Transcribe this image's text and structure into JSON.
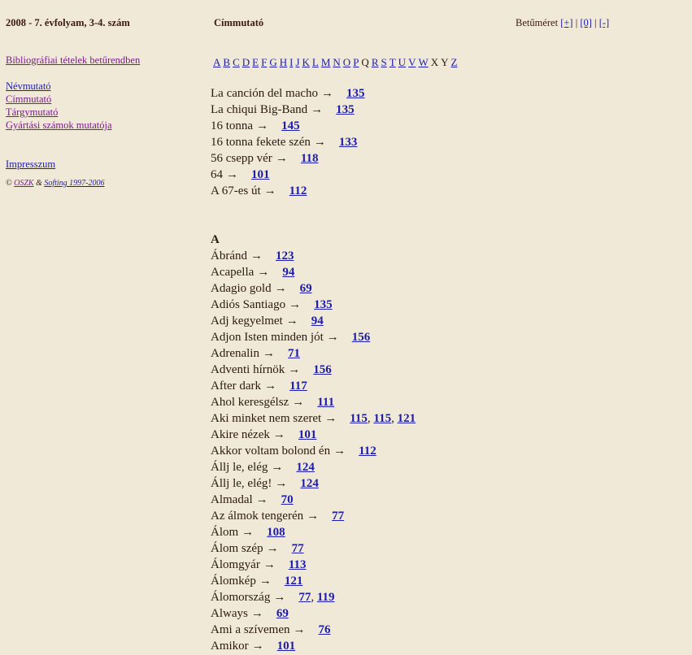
{
  "header": {
    "issue": "2008 - 7. évfolyam, 3-4. szám",
    "section": "Címmutató",
    "fontsize_label": "Betűméret",
    "font_plus": "[+]",
    "font_zero": "[0]",
    "font_minus": "[-]",
    "sep": "|"
  },
  "sidebar": {
    "bibliography": "Bibliográfiai tételek betűrendben",
    "name_index": "Névmutató",
    "title_index": "Címmutató",
    "subject_index": "Tárgymutató",
    "production_index": "Gyártási számok mutatója",
    "impressum": "Impresszum",
    "copyright_symbol": "©",
    "oszk": "OSZK",
    "and": "&",
    "softing": "Softing 1997-2006"
  },
  "alphabet": {
    "letters": [
      "A",
      "B",
      "C",
      "D",
      "E",
      "F",
      "G",
      "H",
      "I",
      "J",
      "K",
      "L",
      "M",
      "N",
      "O",
      "P",
      "Q",
      "R",
      "S",
      "T",
      "U",
      "V",
      "W",
      "X",
      "Y",
      "Z"
    ],
    "inactive": [
      "Q",
      "X",
      "Y"
    ]
  },
  "numeric_entries": [
    {
      "title": "La canción del macho",
      "refs": [
        "135"
      ]
    },
    {
      "title": "La chiqui Big-Band",
      "refs": [
        "135"
      ]
    },
    {
      "title": "16 tonna",
      "refs": [
        "145"
      ]
    },
    {
      "title": "16 tonna fekete szén",
      "refs": [
        "133"
      ]
    },
    {
      "title": "56 csepp vér",
      "refs": [
        "118"
      ]
    },
    {
      "title": "64",
      "refs": [
        "101"
      ]
    },
    {
      "title": "A 67-es út",
      "refs": [
        "112"
      ]
    }
  ],
  "letter_heading": "A",
  "a_entries": [
    {
      "title": "Ábránd",
      "refs": [
        "123"
      ]
    },
    {
      "title": "Acapella",
      "refs": [
        "94"
      ]
    },
    {
      "title": "Adagio gold",
      "refs": [
        "69"
      ]
    },
    {
      "title": "Adiós Santiago",
      "refs": [
        "135"
      ]
    },
    {
      "title": "Adj kegyelmet",
      "refs": [
        "94"
      ]
    },
    {
      "title": "Adjon Isten minden jót",
      "refs": [
        "156"
      ]
    },
    {
      "title": "Adrenalin",
      "refs": [
        "71"
      ]
    },
    {
      "title": "Adventi hírnök",
      "refs": [
        "156"
      ]
    },
    {
      "title": "After dark",
      "refs": [
        "117"
      ]
    },
    {
      "title": "Ahol keresgélsz",
      "refs": [
        "111"
      ]
    },
    {
      "title": "Aki minket nem szeret",
      "refs": [
        "115",
        "115",
        "121"
      ]
    },
    {
      "title": "Akire nézek",
      "refs": [
        "101"
      ]
    },
    {
      "title": "Akkor voltam bolond én",
      "refs": [
        "112"
      ]
    },
    {
      "title": "Állj le, elég",
      "refs": [
        "124"
      ]
    },
    {
      "title": "Állj le, elég!",
      "refs": [
        "124"
      ]
    },
    {
      "title": "Almadal",
      "refs": [
        "70"
      ]
    },
    {
      "title": "Az álmok tengerén",
      "refs": [
        "77"
      ]
    },
    {
      "title": "Álom",
      "refs": [
        "108"
      ]
    },
    {
      "title": "Álom szép",
      "refs": [
        "77"
      ]
    },
    {
      "title": "Álomgyár",
      "refs": [
        "113"
      ]
    },
    {
      "title": "Álomkép",
      "refs": [
        "121"
      ]
    },
    {
      "title": "Álomország",
      "refs": [
        "77",
        "119"
      ]
    },
    {
      "title": "Always",
      "refs": [
        "69"
      ]
    },
    {
      "title": "Ami a szívemen",
      "refs": [
        "76"
      ]
    },
    {
      "title": "Amikor",
      "refs": [
        "101"
      ]
    }
  ],
  "arrow": "→",
  "ref_sep": ","
}
